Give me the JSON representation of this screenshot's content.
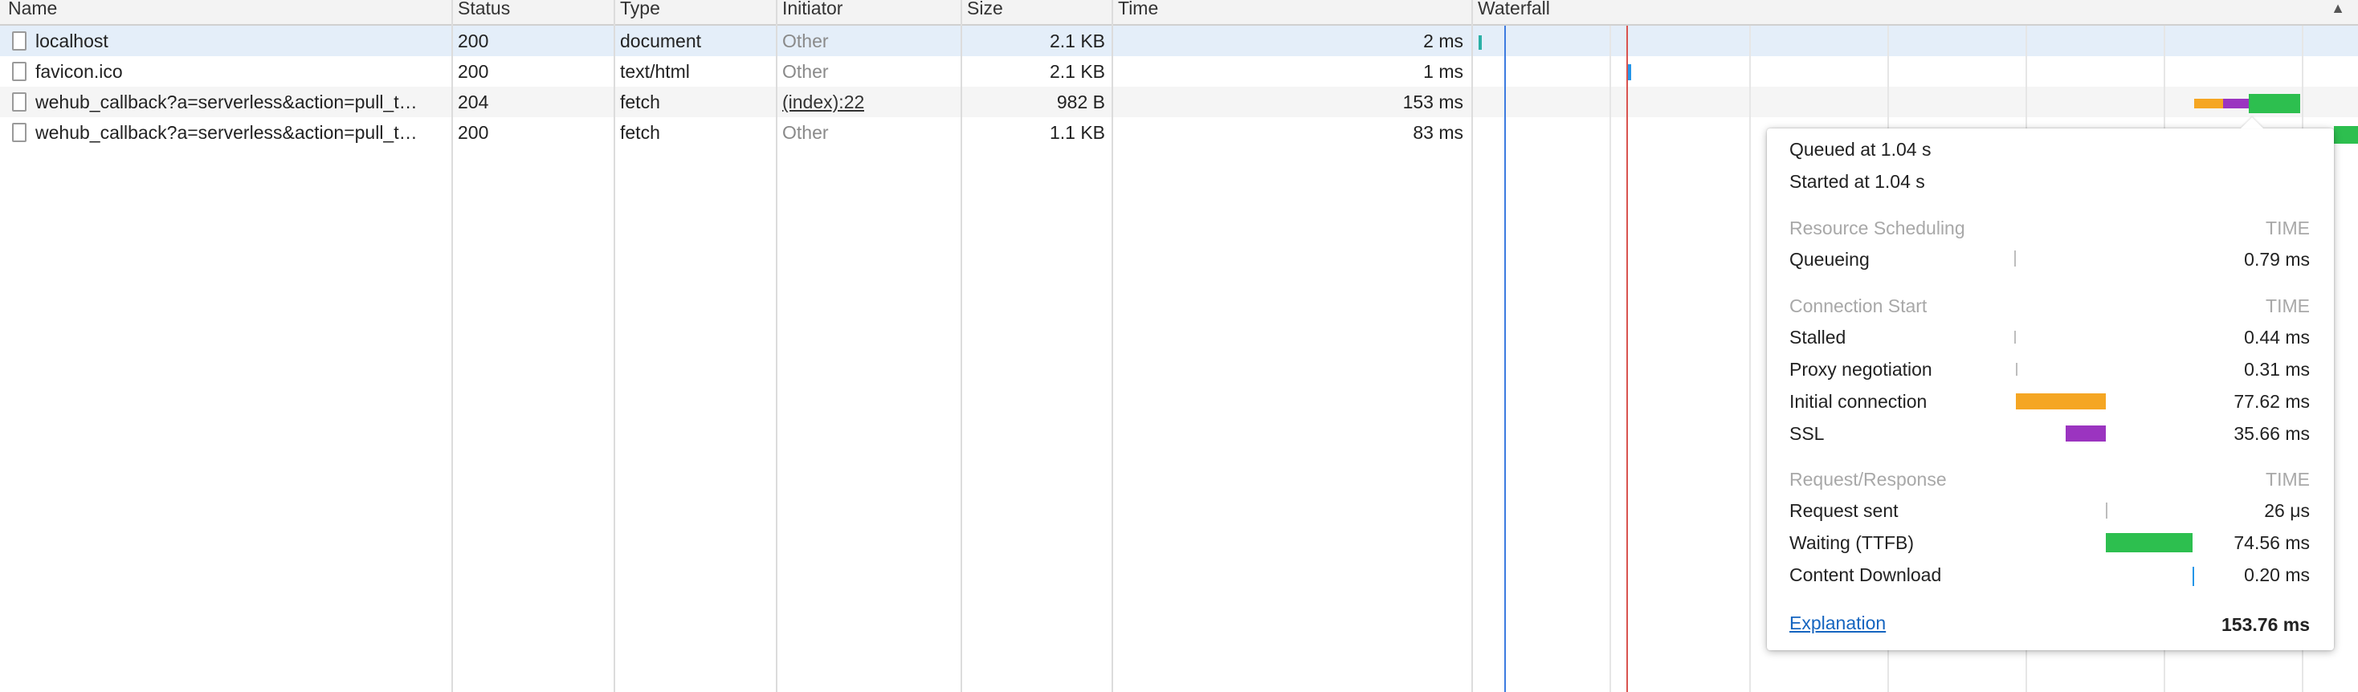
{
  "columns": {
    "name": "Name",
    "status": "Status",
    "type": "Type",
    "initiator": "Initiator",
    "size": "Size",
    "time": "Time",
    "waterfall": "Waterfall",
    "sort_indicator": "▲"
  },
  "rows": [
    {
      "name": "localhost",
      "status": "200",
      "type": "document",
      "initiator": "Other",
      "size": "2.1 KB",
      "time": "2 ms"
    },
    {
      "name": "favicon.ico",
      "status": "200",
      "type": "text/html",
      "initiator": "Other",
      "size": "2.1 KB",
      "time": "1 ms"
    },
    {
      "name": "wehub_callback?a=serverless&action=pull_t…",
      "status": "204",
      "type": "fetch",
      "initiator": "(index):22",
      "size": "982 B",
      "time": "153 ms"
    },
    {
      "name": "wehub_callback?a=serverless&action=pull_t…",
      "status": "200",
      "type": "fetch",
      "initiator": "Other",
      "size": "1.1 KB",
      "time": "83 ms"
    }
  ],
  "timing": {
    "queued_at": "Queued at 1.04 s",
    "started_at": "Started at 1.04 s",
    "time_header": "TIME",
    "resource_scheduling": {
      "title": "Resource Scheduling",
      "items": [
        {
          "label": "Queueing",
          "value": "0.79 ms"
        }
      ]
    },
    "connection_start": {
      "title": "Connection Start",
      "items": [
        {
          "label": "Stalled",
          "value": "0.44 ms"
        },
        {
          "label": "Proxy negotiation",
          "value": "0.31 ms"
        },
        {
          "label": "Initial connection",
          "value": "77.62 ms"
        },
        {
          "label": "SSL",
          "value": "35.66 ms"
        }
      ]
    },
    "request_response": {
      "title": "Request/Response",
      "items": [
        {
          "label": "Request sent",
          "value": "26 μs"
        },
        {
          "label": "Waiting (TTFB)",
          "value": "74.56 ms"
        },
        {
          "label": "Content Download",
          "value": "0.20 ms"
        }
      ]
    },
    "explanation": "Explanation",
    "total": "153.76 ms"
  },
  "colors": {
    "initial_connection": "#f5a623",
    "ssl": "#9b34c0",
    "waiting": "#2dbf4f",
    "content_download": "#2596e8",
    "dom_content_loaded": "#3d7be0",
    "load": "#d9534f"
  }
}
